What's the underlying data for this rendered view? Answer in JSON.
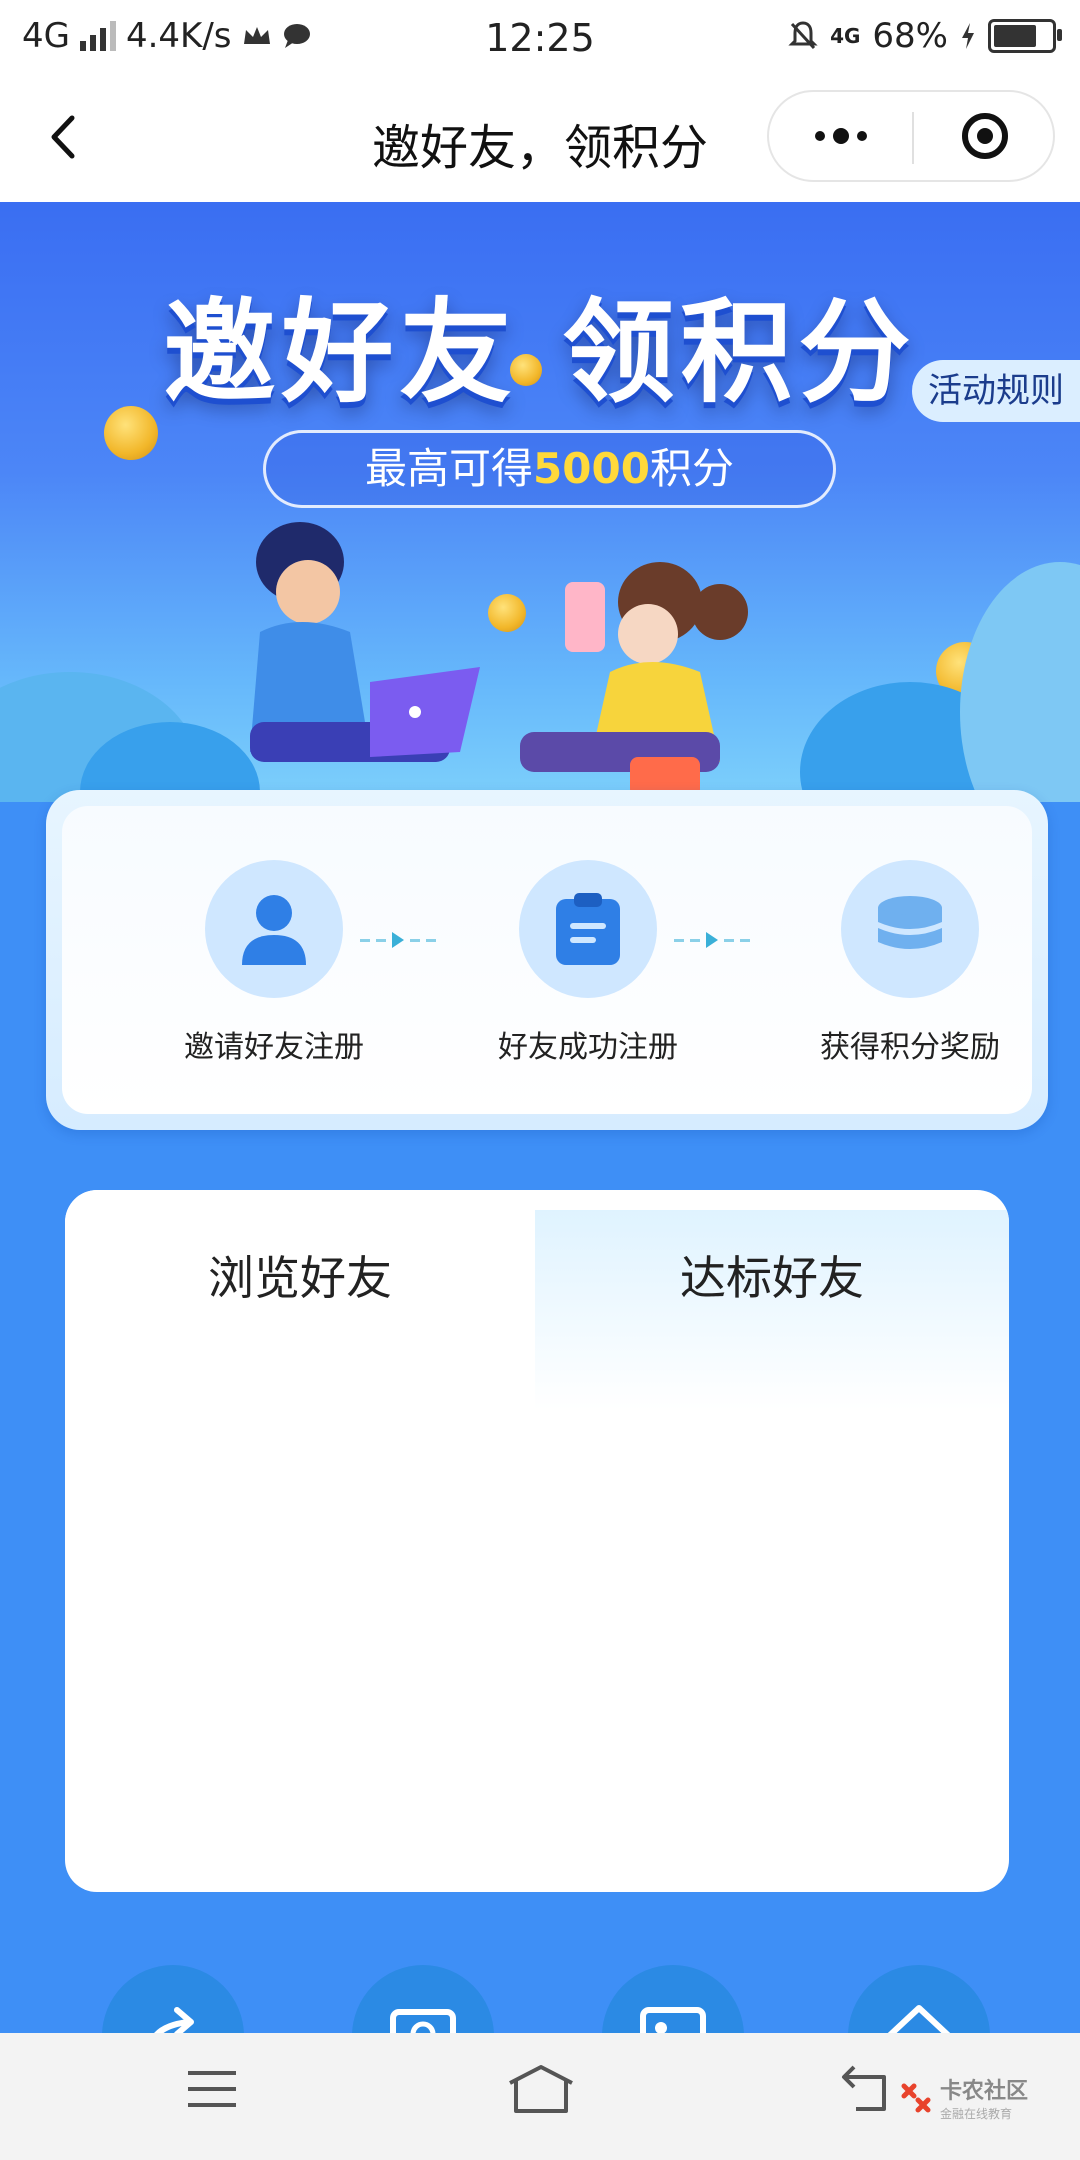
{
  "status_bar": {
    "network": "4G",
    "speed": "4.4K/s",
    "time": "12:25",
    "net_small": "4G",
    "battery": "68%",
    "battery_level": 0.68
  },
  "navbar": {
    "title": "邀好友，领积分"
  },
  "banner": {
    "title": "邀好友 领积分",
    "subtitle_prefix": "最高可得",
    "subtitle_highlight": "5000",
    "subtitle_suffix": "积分",
    "rules_button": "活动规则"
  },
  "steps": [
    {
      "label": "邀请好友注册",
      "icon": "user-icon"
    },
    {
      "label": "好友成功注册",
      "icon": "clipboard-icon"
    },
    {
      "label": "获得积分奖励",
      "icon": "coin-stack-icon"
    }
  ],
  "friends": {
    "tabs": [
      {
        "label": "浏览好友",
        "active": true
      },
      {
        "label": "达标好友",
        "active": false
      }
    ]
  },
  "action_buttons": [
    {
      "icon": "share-icon"
    },
    {
      "icon": "image-icon"
    },
    {
      "icon": "picture-icon"
    },
    {
      "icon": "home-icon"
    }
  ],
  "system_nav": {
    "watermark_title": "卡农社区",
    "watermark_sub": "金融在线教育"
  },
  "colors": {
    "primary_blue": "#3e8ff6",
    "highlight_yellow": "#ffd93a",
    "step_circle": "#cfe7ff"
  }
}
